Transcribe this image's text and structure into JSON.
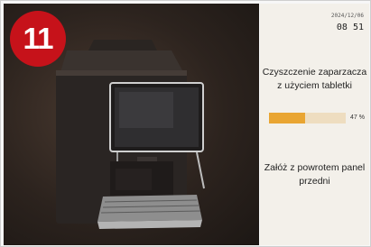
{
  "step": {
    "number": "11"
  },
  "status": {
    "date": "2024/12/06",
    "time": "08 51"
  },
  "cleaning": {
    "title": "Czyszczenie zaparzacza z użyciem tabletki",
    "progress_value": 47,
    "progress_label": "47 %",
    "instruction": "Załóż z powrotem panel przedni"
  },
  "colors": {
    "badge": "#c6121a",
    "progress_fill": "#e9a532",
    "progress_track": "#eeddc0",
    "panel_bg": "#f3f0ea"
  }
}
